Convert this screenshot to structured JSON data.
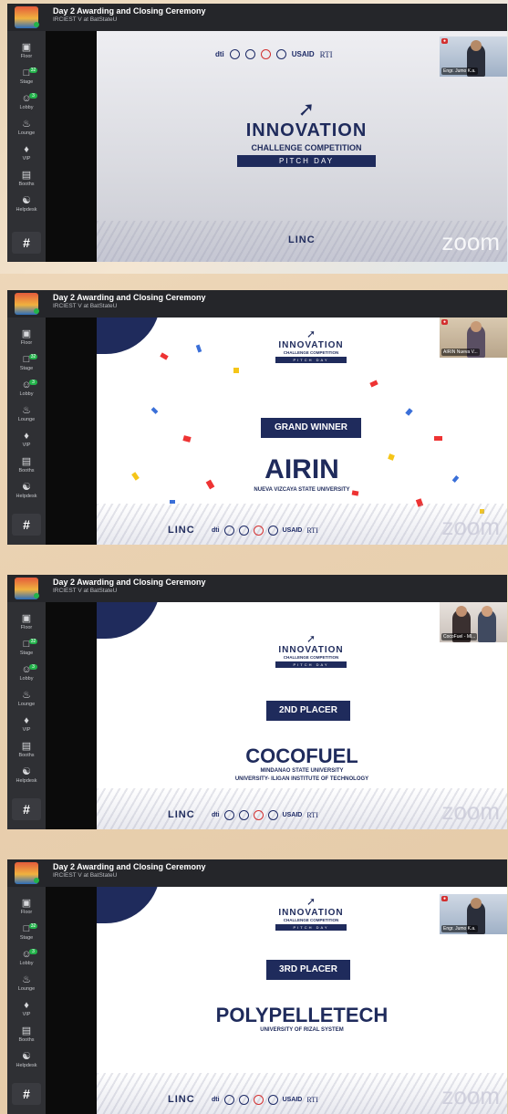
{
  "window": {
    "title": "Day 2 Awarding and Closing Ceremony",
    "subtitle": "IRCIEST V at BatStateU"
  },
  "sidebar": {
    "items": [
      {
        "label": "Floor",
        "icon": "map-icon"
      },
      {
        "label": "Stage",
        "icon": "stage-icon",
        "badge": "32"
      },
      {
        "label": "Lobby",
        "icon": "people-icon",
        "badge": "3"
      },
      {
        "label": "Lounge",
        "icon": "lounge-icon"
      },
      {
        "label": "VIP",
        "icon": "vip-icon"
      },
      {
        "label": "Booths",
        "icon": "booth-icon"
      },
      {
        "label": "Helpdesk",
        "icon": "helpdesk-icon"
      }
    ],
    "hash": "#"
  },
  "slides": [
    {
      "big": "INNOVATION",
      "small": "CHALLENGE COMPETITION",
      "pitch": "PITCH DAY",
      "linc": "LINC",
      "zoom": "zoom",
      "sponsors": [
        "dti",
        "USAID",
        "RTI"
      ],
      "cam_name": "Engr. Jumo K.a."
    },
    {
      "big": "INNOVATION",
      "small": "CHALLENGE COMPETITION",
      "pitch": "PITCH DAY",
      "badge": "GRAND WINNER",
      "winner": "AIRIN",
      "uni1": "NUEVA VIZCAYA STATE UNIVERSITY",
      "linc": "LINC",
      "zoom": "zoom",
      "sponsors": [
        "dti",
        "USAID",
        "RTI"
      ],
      "cam_name": "AIRIN Nueva V..."
    },
    {
      "big": "INNOVATION",
      "small": "CHALLENGE COMPETITION",
      "pitch": "PITCH DAY",
      "badge": "2ND PLACER",
      "winner": "COCOFUEL",
      "uni1": "MINDANAO STATE UNIVERSITY",
      "uni2": "UNIVERSITY- ILIGAN INSTITUTE OF TECHNOLOGY",
      "linc": "LINC",
      "zoom": "zoom",
      "sponsors": [
        "dti",
        "USAID",
        "RTI"
      ],
      "cam_name": "CocoFuel - Ml..."
    },
    {
      "big": "INNOVATION",
      "small": "CHALLENGE COMPETITION",
      "pitch": "PITCH DAY",
      "badge": "3RD PLACER",
      "winner": "POLYPELLETECH",
      "uni1": "UNIVERSITY OF RIZAL SYSTEM",
      "linc": "LINC",
      "zoom": "zoom",
      "sponsors": [
        "dti",
        "USAID",
        "RTI"
      ],
      "cam_name": "Engr. Jumo K.a."
    }
  ]
}
